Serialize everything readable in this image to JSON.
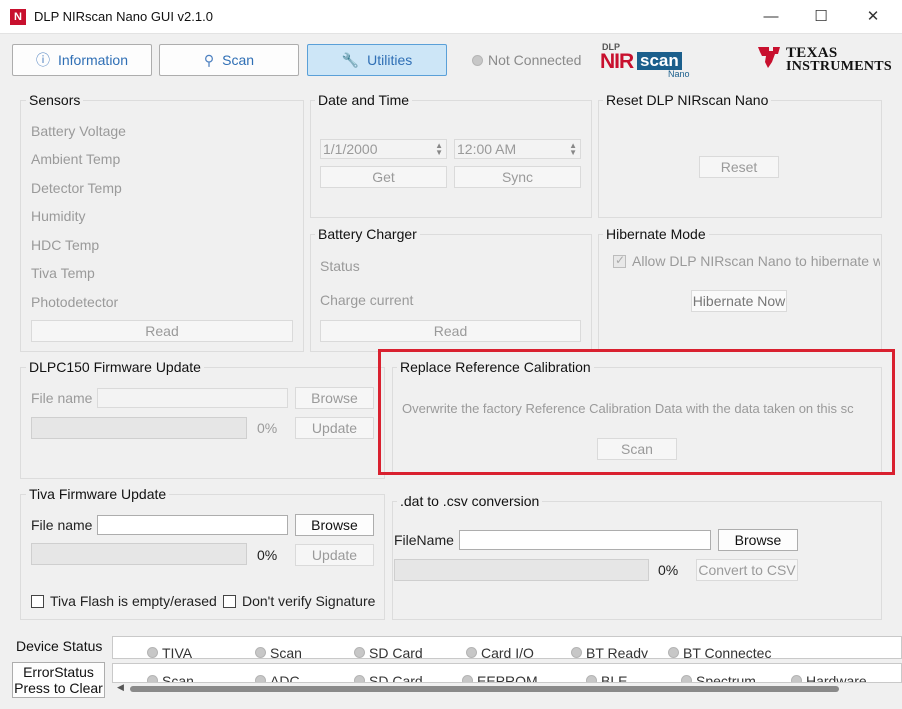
{
  "window": {
    "title": "DLP NIRscan Nano GUI v2.1.0",
    "min_icon": "—",
    "max_icon": "☐",
    "close_icon": "✕",
    "app_icon_glyph": "N"
  },
  "tabs": [
    {
      "label": "Information",
      "icon": "ⓘ",
      "icon_name": "info-icon"
    },
    {
      "label": "Scan",
      "icon": "⚲",
      "icon_name": "key-icon"
    },
    {
      "label": "Utilities",
      "icon": "🔧",
      "icon_name": "wrench-icon"
    }
  ],
  "connection": {
    "status": "Not Connected"
  },
  "logos": {
    "dlp": "DLP",
    "nir": "NIR",
    "scan": "scan",
    "nano": "Nano",
    "ti_line1": "Texas",
    "ti_line2": "Instruments"
  },
  "sensors": {
    "title": "Sensors",
    "items": [
      "Battery Voltage",
      "Ambient Temp",
      "Detector Temp",
      "Humidity",
      "HDC Temp",
      "Tiva Temp",
      "Photodetector"
    ],
    "read_label": "Read"
  },
  "datetime": {
    "title": "Date and Time",
    "date_value": "1/1/2000",
    "time_value": "12:00 AM",
    "get_label": "Get",
    "sync_label": "Sync"
  },
  "reset": {
    "title": "Reset DLP NIRscan Nano",
    "button_label": "Reset"
  },
  "battery": {
    "title": "Battery Charger",
    "status_label": "Status",
    "charge_label": "Charge current",
    "read_label": "Read"
  },
  "hibernate": {
    "title": "Hibernate Mode",
    "allow_label": "Allow DLP NIRscan Nano to hibernate w",
    "button_label": "Hibernate Now"
  },
  "dlpc_fw": {
    "title": "DLPC150 Firmware Update",
    "file_label": "File name",
    "browse_label": "Browse",
    "percent": "0%",
    "update_label": "Update"
  },
  "ref_cal": {
    "title": "Replace Reference Calibration",
    "description": "Overwrite the factory Reference Calibration Data with the data taken on this sc",
    "scan_label": "Scan"
  },
  "tiva_fw": {
    "title": "Tiva Firmware Update",
    "file_label": "File name",
    "browse_label": "Browse",
    "percent": "0%",
    "update_label": "Update",
    "empty_label": "Tiva Flash is empty/erased",
    "verify_label": "Don't verify Signature"
  },
  "dat_csv": {
    "title": ".dat to .csv conversion",
    "file_label": "FileName",
    "browse_label": "Browse",
    "percent": "0%",
    "convert_label": "Convert to CSV"
  },
  "device_status": {
    "label": "Device Status",
    "items": [
      "TIVA",
      "Scan",
      "SD Card",
      "Card I/O",
      "BT Ready",
      "BT Connectec"
    ]
  },
  "error_status": {
    "label_line1": "ErrorStatus",
    "label_line2": "Press to Clear",
    "items": [
      "Scan",
      "ADC",
      "SD Card",
      "EEPROM",
      "BLE",
      "Spectrum",
      "Hardware"
    ]
  },
  "colors": {
    "accent_blue": "#2f6fb5",
    "active_tab": "#cde6f7",
    "highlight_red": "#d9202f",
    "brand_red": "#c8102e"
  }
}
